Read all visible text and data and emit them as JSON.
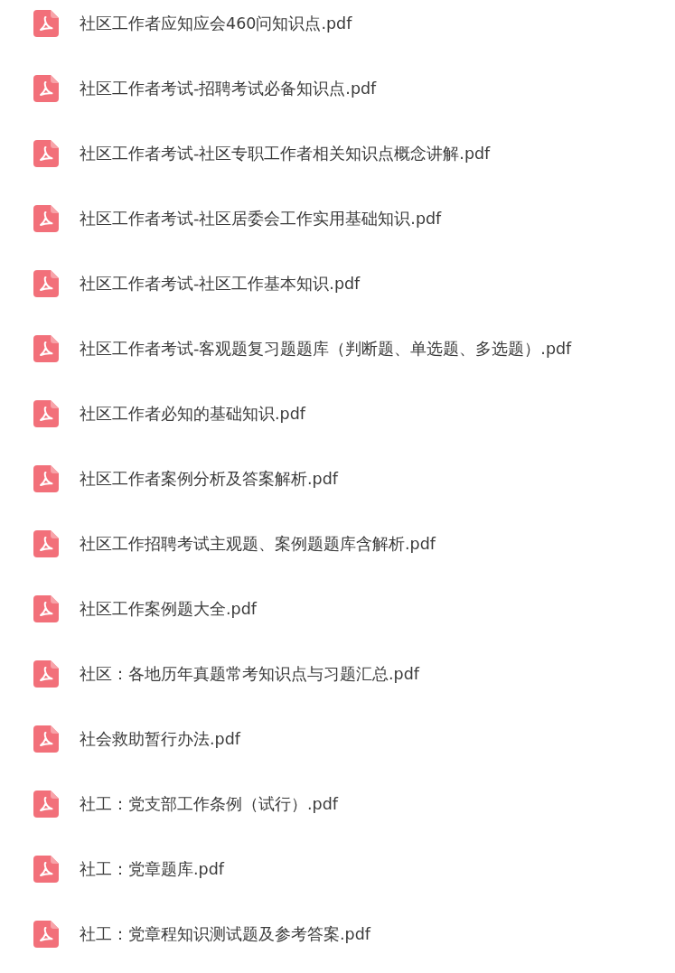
{
  "files": [
    {
      "name": "社区工作者应知应会460问知识点.pdf"
    },
    {
      "name": "社区工作者考试-招聘考试必备知识点.pdf"
    },
    {
      "name": "社区工作者考试-社区专职工作者相关知识点概念讲解.pdf"
    },
    {
      "name": "社区工作者考试-社区居委会工作实用基础知识.pdf"
    },
    {
      "name": "社区工作者考试-社区工作基本知识.pdf"
    },
    {
      "name": "社区工作者考试-客观题复习题题库（判断题、单选题、多选题）.pdf"
    },
    {
      "name": "社区工作者必知的基础知识.pdf"
    },
    {
      "name": "社区工作者案例分析及答案解析.pdf"
    },
    {
      "name": "社区工作招聘考试主观题、案例题题库含解析.pdf"
    },
    {
      "name": "社区工作案例题大全.pdf"
    },
    {
      "name": "社区：各地历年真题常考知识点与习题汇总.pdf"
    },
    {
      "name": "社会救助暂行办法.pdf"
    },
    {
      "name": "社工：党支部工作条例（试行）.pdf"
    },
    {
      "name": "社工：党章题库.pdf"
    },
    {
      "name": "社工：党章程知识测试题及参考答案.pdf"
    }
  ]
}
